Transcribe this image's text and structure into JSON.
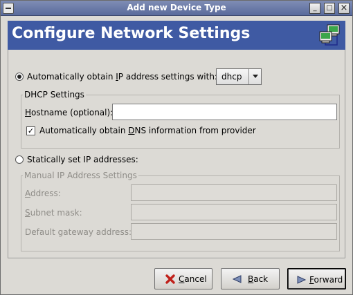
{
  "window": {
    "title": "Add new Device Type",
    "controls": {
      "minimize": "_",
      "maximize": "□",
      "close": "×"
    }
  },
  "header": {
    "title": "Configure Network Settings",
    "icon": "network-computers-icon"
  },
  "auto_ip": {
    "selected": true,
    "label_pre": "Automatically obtain ",
    "label_accel": "I",
    "label_post": "P address settings with:",
    "method_value": "dhcp"
  },
  "dhcp_settings": {
    "title": "DHCP Settings",
    "hostname_label_accel": "H",
    "hostname_label_rest": "ostname (optional):",
    "hostname_value": "",
    "dns_checked": true,
    "dns_check_mark": "✓",
    "dns_label_pre": "Automatically obtain ",
    "dns_label_accel": "D",
    "dns_label_post": "NS information from provider"
  },
  "static_ip": {
    "selected": false,
    "label": "Statically set IP addresses:"
  },
  "manual_settings": {
    "title": "Manual IP Address Settings",
    "address_accel": "A",
    "address_rest": "ddress:",
    "subnet_accel": "S",
    "subnet_rest": "ubnet mask:",
    "gateway_label": "Default gateway address:",
    "address_value": "",
    "subnet_value": "",
    "gateway_value": ""
  },
  "buttons": {
    "cancel_accel": "C",
    "cancel_rest": "ancel",
    "back_accel": "B",
    "back_rest": "ack",
    "forward_accel": "F",
    "forward_rest": "orward"
  },
  "colors": {
    "header_bg": "#3f5aa3",
    "titlebar": "#6a79a8",
    "window_bg": "#dcdad5"
  }
}
